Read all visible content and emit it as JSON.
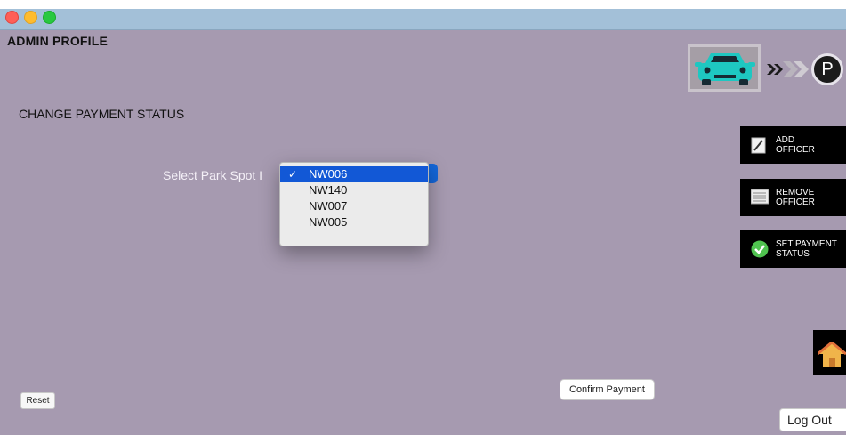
{
  "window": {
    "title_controls": {
      "close": "close-control",
      "minimize": "minimize-control",
      "zoom": "zoom-control"
    }
  },
  "header": {
    "title": "ADMIN PROFILE"
  },
  "logo": {
    "icons": [
      "car-icon",
      "double-chevron-icon",
      "parking-icon"
    ],
    "parking_letter": "P"
  },
  "main": {
    "section_title": "CHANGE PAYMENT STATUS",
    "select_label": "Select Park Spot I",
    "dropdown": {
      "selected": "NW006",
      "check_mark": "✓",
      "options": [
        "NW006",
        "NW140",
        "NW007",
        "NW005"
      ]
    }
  },
  "sidebar": {
    "items": [
      {
        "label_line1": "ADD",
        "label_line2": "OFFICER",
        "icon": "edit-icon"
      },
      {
        "label_line1": "REMOVE",
        "label_line2": "OFFICER",
        "icon": "list-icon"
      },
      {
        "label_line1": "SET PAYMENT",
        "label_line2": "STATUS",
        "icon": "check-circle-icon"
      }
    ],
    "home_icon": "home-icon"
  },
  "footer": {
    "reset_label": "Reset",
    "confirm_label": "Confirm Payment",
    "logout_label": "Log Out"
  },
  "colors": {
    "background": "#a69ab0",
    "accent": "#1258d6",
    "car": "#1ec7c1",
    "sidebar_button": "#000000"
  }
}
